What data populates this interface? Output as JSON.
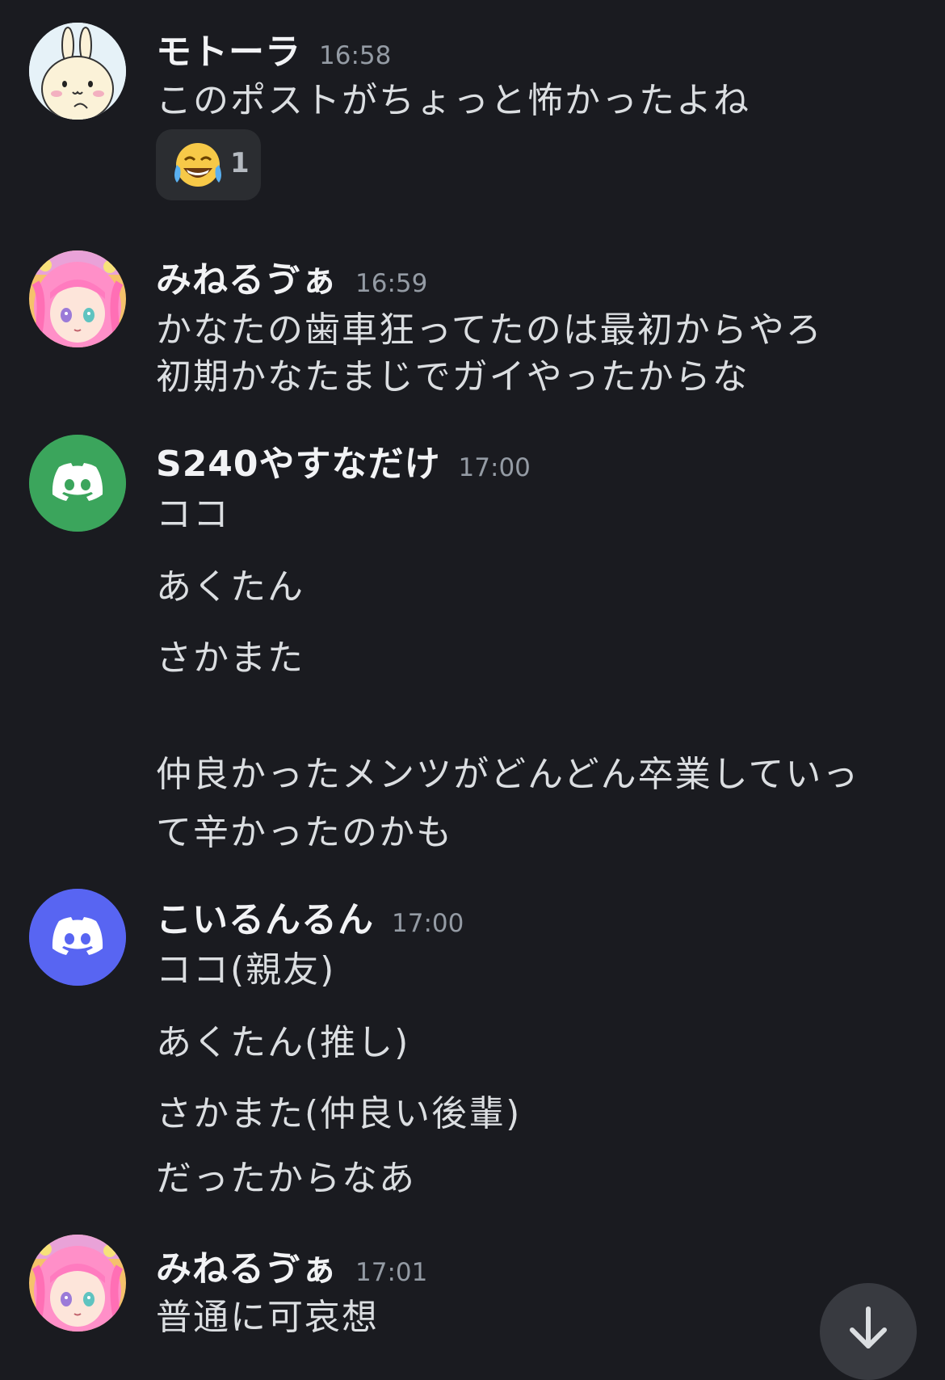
{
  "messages": [
    {
      "username": "モトーラ",
      "time": "16:58",
      "avatar": "rabbit-character-avatar",
      "lines": [
        "このポストがちょっと怖かったよね"
      ],
      "reaction": {
        "emoji": "joy-tears-emoji",
        "count": "1"
      }
    },
    {
      "username": "みねるゔぁ",
      "time": "16:59",
      "avatar": "anime-girl-pink-hair-avatar",
      "lines": [
        "かなたの歯車狂ってたのは最初からやろ",
        "初期かなたまじでガイやったからな"
      ]
    },
    {
      "username": "S240やすなだけ",
      "time": "17:00",
      "avatar": "discord-default-avatar-green",
      "lines": [
        "ココ",
        "あくたん",
        "さかまた",
        "仲良かったメンツがどんどん卒業していっ",
        "て辛かったのかも"
      ]
    },
    {
      "username": "こいるんるん",
      "time": "17:00",
      "avatar": "discord-default-avatar-blurple",
      "lines": [
        "ココ(親友)",
        "あくたん(推し)",
        "さかまた(仲良い後輩)",
        "だったからなあ"
      ]
    },
    {
      "username": "みねるゔぁ",
      "time": "17:01",
      "avatar": "anime-girl-pink-hair-avatar",
      "lines": [
        "普通に可哀想"
      ]
    }
  ],
  "colors": {
    "background": "#1a1b20",
    "discord_green": "#3ba55c",
    "discord_blurple": "#5865f2"
  },
  "scroll_button": {
    "icon": "arrow-down-icon"
  }
}
